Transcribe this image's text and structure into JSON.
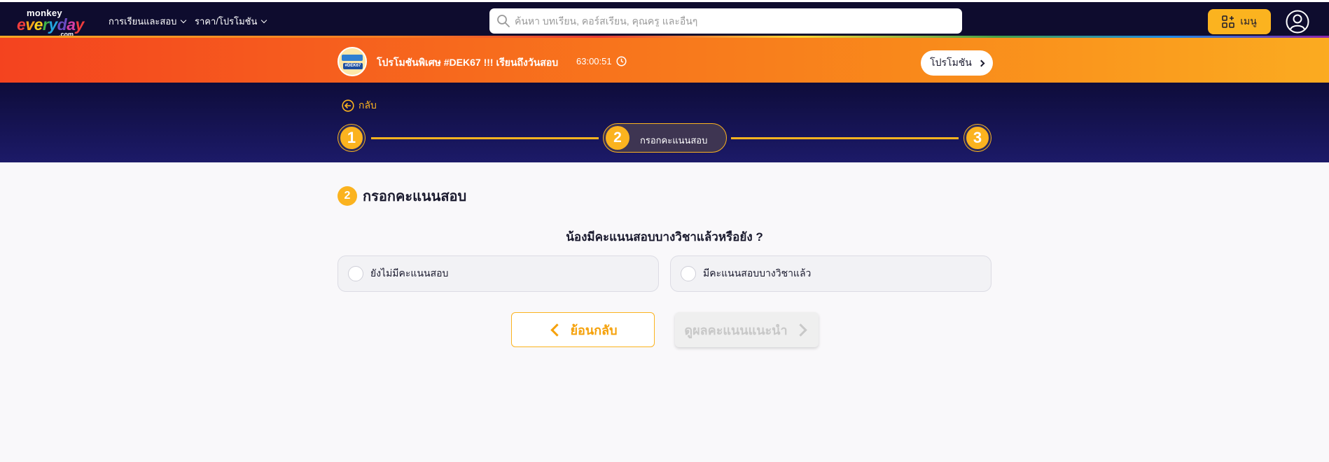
{
  "brand": {
    "logo_top": "monkey",
    "logo_main": "everyday",
    "logo_sub": ".com"
  },
  "nav": {
    "items": [
      {
        "label": "การเรียนและสอบ"
      },
      {
        "label": "ราคา/โปรโมชัน"
      }
    ],
    "search_placeholder": "ค้นหา บทเรียน, คอร์สเรียน, คุณครู และอื่นๆ",
    "menu_label": "เมนู"
  },
  "promo": {
    "badge_text": "#DEK67",
    "title": "โปรโมชันพิเศษ #DEK67 !!! เรียนถึงวันสอบ",
    "timer": "63:00:51",
    "button_label": "โปรโมชัน"
  },
  "stepper": {
    "back_label": "กลับ",
    "steps": [
      {
        "number": "1"
      },
      {
        "number": "2",
        "label": "กรอกคะแนนสอบ"
      },
      {
        "number": "3"
      }
    ]
  },
  "section": {
    "number": "2",
    "title": "กรอกคะแนนสอบ",
    "question": "น้องมีคะแนนสอบบางวิชาแล้วหรือยัง ?",
    "options": [
      {
        "label": "ยังไม่มีคะแนนสอบ"
      },
      {
        "label": "มีคะแนนสอบบางวิชาแล้ว"
      }
    ],
    "back_button": "ย้อนกลับ",
    "next_button": "ดูผลคะแนนแนะนำ"
  },
  "colors": {
    "accent": "#fbb31f",
    "navbar": "#0e0c2e",
    "step_band": "#1c1a68",
    "disabled": "#c8c8c8"
  },
  "icons": [
    "search-icon",
    "chevron-down-icon",
    "apps-icon",
    "user-icon",
    "clock-icon",
    "chevron-right-icon",
    "back-arrow-icon",
    "chevron-left-icon"
  ]
}
